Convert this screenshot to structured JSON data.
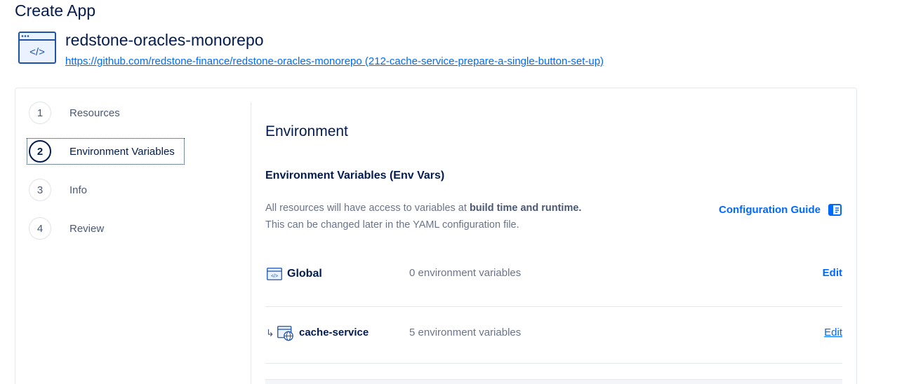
{
  "page": {
    "title": "Create App"
  },
  "repo": {
    "name": "redstone-oracles-monorepo",
    "link": "https://github.com/redstone-finance/redstone-oracles-monorepo (212-cache-service-prepare-a-single-button-set-up)",
    "icon": "code-window-icon"
  },
  "steps": [
    {
      "number": "1",
      "label": "Resources"
    },
    {
      "number": "2",
      "label": "Environment Variables"
    },
    {
      "number": "3",
      "label": "Info"
    },
    {
      "number": "4",
      "label": "Review"
    }
  ],
  "active_step": 2,
  "main": {
    "title": "Environment",
    "subtitle": "Environment Variables (Env Vars)",
    "desc_line1_prefix": "All resources will have access to variables at ",
    "desc_line1_bold": "build time and runtime.",
    "desc_line2": "This can be changed later in the YAML configuration file.",
    "guide_label": "Configuration Guide",
    "guide_icon": "book-icon"
  },
  "env_rows": [
    {
      "name": "Global",
      "count": "0 environment variables",
      "edit": "Edit",
      "icon": "code-window-icon"
    },
    {
      "name": "cache-service",
      "count": "5 environment variables",
      "edit": "Edit",
      "icon": "web-service-icon",
      "prefix": "↳"
    }
  ],
  "colors": {
    "primary": "#0069ff",
    "heading": "#031b4e",
    "muted": "#6a7387"
  }
}
